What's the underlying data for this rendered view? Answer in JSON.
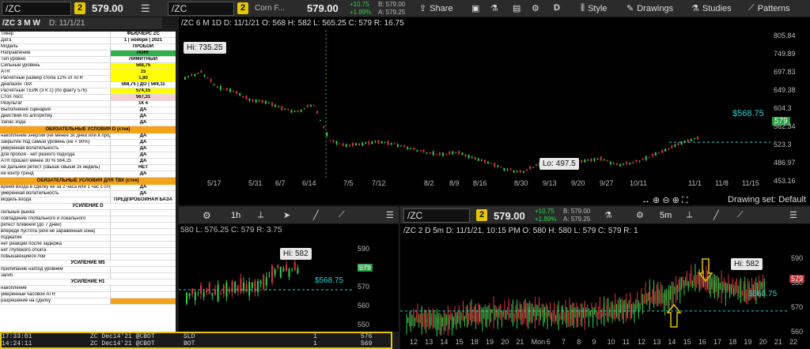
{
  "top": {
    "symbol_left": "/ZC",
    "badge_left": "2",
    "price_left": "579.00",
    "symbol_main": "/ZC",
    "title_main": "Corn F...",
    "price_main": "579.00",
    "chg": "+10.75",
    "chg_pct": "+1.89%",
    "bid": "B: 579.00",
    "ask": "A: 579.25",
    "share": "Share",
    "d_label": "D",
    "style": "Style",
    "drawings": "Drawings",
    "studies": "Studies",
    "patterns": "Patterns"
  },
  "left_header": {
    "symbol": "/ZC 3 M W",
    "date": "D: 11/1/21"
  },
  "main_chart": {
    "header": "/ZC 6 M 1D  D: 11/1/21  O: 568  H: 582  L: 565.25  C: 579  R: 16.75",
    "hi": "Hi: 735.25",
    "lo": "Lo: 497.5",
    "last": "$568.75",
    "last_badge": "579",
    "y_ticks": [
      "805.84",
      "749.89",
      "697.83",
      "649.38",
      "604.3",
      "562.34",
      "523.3",
      "486.97",
      "453.16"
    ],
    "x_ticks": [
      "5/17",
      "5/31",
      "6/7",
      "6/14",
      "7/5",
      "7/12",
      "8/2",
      "8/9",
      "8/16",
      "8/30",
      "9/13",
      "9/20",
      "9/27",
      "10/11",
      "11/1",
      "11/8",
      "11/15"
    ],
    "drawing_set": "Drawing set: Default"
  },
  "sheet": {
    "rows": [
      [
        "Тикер",
        "ФЬЮЧЕРС ZC"
      ],
      [
        "Дата",
        "1 | ноября | 2021"
      ],
      [
        "Модель",
        "ПРОБОЙ"
      ],
      [
        "Направление",
        "ЛОНГ"
      ],
      [
        "Тип уровня",
        "ЛИМИТНЫЙ"
      ],
      [
        "Сильный уровень",
        "568,75"
      ],
      [
        "ATR",
        "15"
      ],
      [
        "Расчётный размер стопа 12% от ATR",
        "1,80"
      ],
      [
        "Диапазон ТВХ",
        "568,75 | ДО | 569,11"
      ],
      [
        "Расчётный ТЕЙК (3 К 1) (по факту 576)",
        "574,15"
      ],
      [
        "Стоп лосс",
        "567,31"
      ],
      [
        "Результат",
        "1К 4"
      ],
      [
        "Выполнение сценария",
        "ДА"
      ],
      [
        "Действия по алгоритму",
        "ДА"
      ],
      [
        "Запас хода",
        "ДА"
      ]
    ],
    "hdr1": "ОБЯЗАТЕЛЬНЫЕ УСЛОВИЯ D (стек)",
    "rows2": [
      [
        "накопление энергии (не менее 3х дней или в продолжение движения (идём не >4 дней)",
        "ДА"
      ],
      [
        "закрытие под самый уровень (не < 90%)",
        "ДА"
      ],
      [
        "умеренная волатильность",
        "ДА"
      ],
      [
        "для пробоя - нет резкого подхода",
        "ДА"
      ],
      [
        "ATR прошёл менее 30 %   564,25",
        "ДА"
      ],
      [
        "не дальний ретест (свыше свыше 2к недель)",
        "НЕТ"
      ],
      [
        "не контр тренд",
        "ДА"
      ]
    ],
    "hdr2": "ОБЯЗАТЕЛЬНЫЕ УСЛОВИЯ ДЛЯ ТВХ (стек)",
    "rows3": [
      [
        "время входа в сделку не за 2 часа или 1 час с открытия сессии",
        "ДА"
      ],
      [
        "умеренная волатильность",
        "ДА"
      ],
      [
        "модель входа",
        "ПРЕДПРОБОЙНАЯ БАЗА"
      ]
    ],
    "sec1": "УСИЛЕНИЕ D",
    "rows4": [
      "сильные рынка",
      "совпадение глобального и локального",
      "ретест ближний (до 7 дней)",
      "впереди пустота (или не зараженная зона)",
      "поджатие",
      "нет реакции после задержа",
      "нет глубокого отката",
      "повышающиеся лои"
    ],
    "sec2": "УСИЛЕНИЕ М5",
    "rows5": [
      "прилипание на/под уровнем",
      "загиб"
    ],
    "sec3": "УСИЛЕНИЕ Н1",
    "rows6": [
      "накопление",
      "умеренный часовой ATR",
      "разрешение на сделку"
    ]
  },
  "mid_chart": {
    "tf": "1h",
    "header": "580  L: 576.25  C: 579  R: 3.75",
    "hi": "Hi: 582",
    "last": "$568.75",
    "badge": "579",
    "y_ticks": [
      "590",
      "580",
      "570",
      "560",
      "550"
    ]
  },
  "right_chart": {
    "symbol": "/ZC",
    "badge": "2",
    "price": "579.00",
    "chg": "+10.75",
    "chg_pct": "+1.89%",
    "bid": "B: 579.00",
    "ask": "A: 579.25",
    "tf": "5m",
    "header": "/ZC 2 D 5m  D: 11/1/21, 10:15 PM  O: 580  H: 580  L: 579  C: 579  R: 1",
    "hi": "Hi: 582",
    "last": "$568.75",
    "badge_price": "579",
    "y_ticks": [
      "590",
      "580",
      "570",
      "560"
    ],
    "x_ticks": [
      "12",
      "13",
      "14",
      "15",
      "18",
      "19",
      "20",
      "21",
      "Mon",
      "6",
      "7",
      "8",
      "9",
      "10",
      "11",
      "12",
      "13",
      "14",
      "15",
      "16",
      "17",
      "18",
      "19",
      "20",
      "21",
      "22"
    ]
  },
  "trades": [
    {
      "time": "17:33:01",
      "desc": "ZC Dec14'21 @CBOT",
      "side": "SLD",
      "qty": "1",
      "px": "576"
    },
    {
      "time": "14:24:11",
      "desc": "ZC Dec14'21 @CBOT",
      "side": "BOT",
      "qty": "1",
      "px": "569"
    }
  ]
}
